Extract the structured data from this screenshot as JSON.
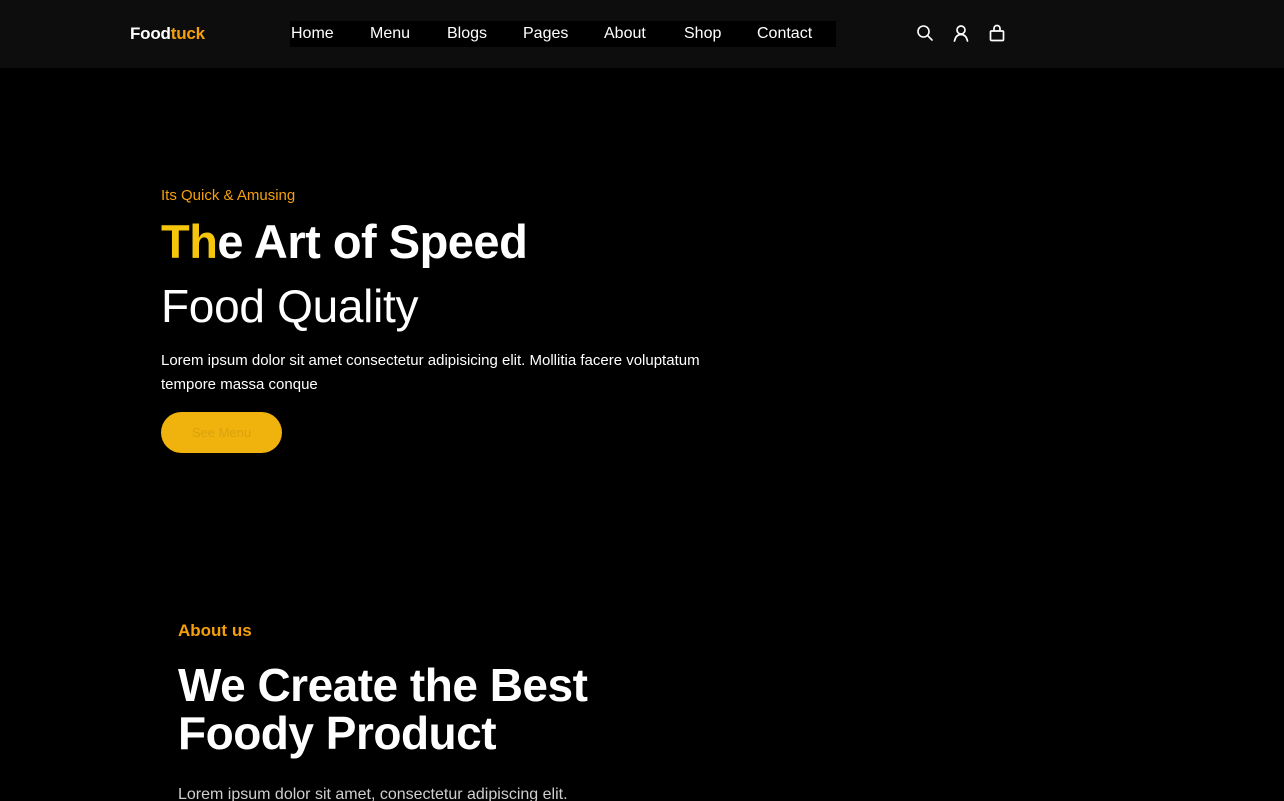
{
  "header": {
    "logo_part1": "Food",
    "logo_part2": "tuck",
    "nav": [
      "Home",
      "Menu",
      "Blogs",
      "Pages",
      "About",
      "Shop",
      "Contact"
    ],
    "icons": [
      "search-icon",
      "user-icon",
      "bag-icon"
    ]
  },
  "hero": {
    "tagline": "Its Quick & Amusing",
    "title_highlight": "Th",
    "title_rest": "e Art of Speed",
    "subtitle": "Food Quality",
    "description": "Lorem ipsum dolor sit amet consectetur adipisicing elit. Mollitia facere voluptatum tempore massa conque",
    "button_label": "See Menu"
  },
  "about": {
    "label": "About us",
    "title": "We Create the Best Foody Product",
    "text": "Lorem ipsum dolor sit amet, consectetur adipiscing elit."
  },
  "colors": {
    "accent": "#f5a00b",
    "highlight": "#f5c60c",
    "button": "#f0b20c",
    "background": "#000000",
    "header_bg": "#0d0d0d"
  }
}
